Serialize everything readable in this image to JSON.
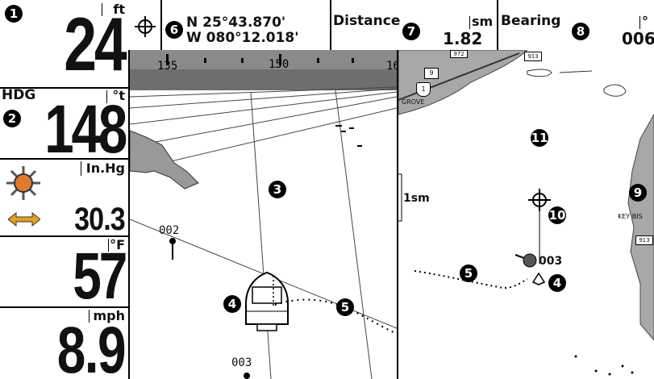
{
  "gauges": {
    "depth": {
      "unit": "ft",
      "value": "24"
    },
    "heading": {
      "label": "HDG",
      "unit": "°t",
      "value": "148"
    },
    "pressure": {
      "unit": "In.Hg",
      "value": "30.3"
    },
    "temperature": {
      "unit": "°F",
      "value": "57"
    },
    "speed": {
      "unit": "mph",
      "value": "8.9"
    }
  },
  "topbar": {
    "lat": "N 25°43.870'",
    "lon": "W 080°12.018'",
    "distance_label": "Distance",
    "distance_unit": "sm",
    "distance_value": "1.82",
    "bearing_label": "Bearing",
    "bearing_unit": "°",
    "bearing_value": "006"
  },
  "view3d": {
    "ticks": [
      "135",
      "150",
      "16"
    ],
    "waypoints": [
      "002",
      "003"
    ]
  },
  "chart": {
    "scale": "1sm",
    "waypoint": "003",
    "roads": [
      "9",
      "1",
      "913",
      "913",
      "972"
    ],
    "place_grove": "GROVE",
    "place_key": "KEY BIS"
  },
  "callouts": [
    "1",
    "2",
    "3",
    "4",
    "5",
    "6",
    "7",
    "8",
    "9",
    "10",
    "11"
  ],
  "icons": [
    "crosshair-icon",
    "sun-icon",
    "arrows-icon",
    "boat-icon",
    "waypoint-icon",
    "cursor-icon"
  ]
}
